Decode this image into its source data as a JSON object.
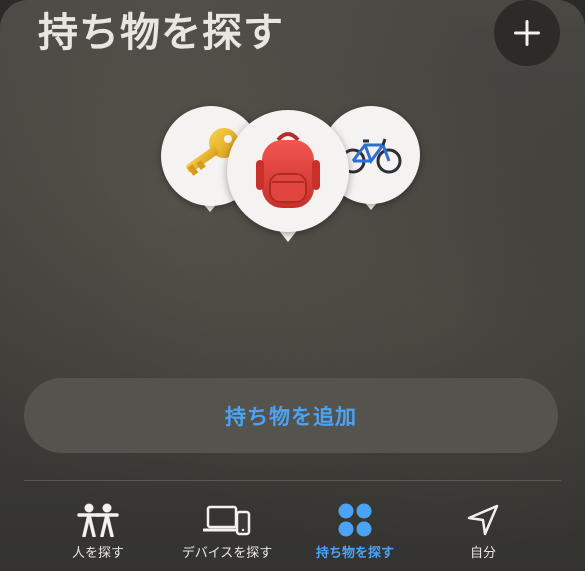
{
  "header": {
    "title": "持ち物を探す"
  },
  "add_button_icon": "plus-icon",
  "items": [
    {
      "name": "key",
      "icon": "key-icon"
    },
    {
      "name": "backpack",
      "icon": "backpack-icon"
    },
    {
      "name": "bicycle",
      "icon": "bicycle-icon"
    }
  ],
  "add_item_label": "持ち物を追加",
  "tabs": [
    {
      "label": "人を探す",
      "icon": "people-icon",
      "active": false
    },
    {
      "label": "デバイスを探す",
      "icon": "devices-icon",
      "active": false
    },
    {
      "label": "持ち物を探す",
      "icon": "items-icon",
      "active": true
    },
    {
      "label": "自分",
      "icon": "location-arrow-icon",
      "active": false
    }
  ],
  "colors": {
    "accent": "#4aa3f5",
    "background": "#3f3d39"
  }
}
